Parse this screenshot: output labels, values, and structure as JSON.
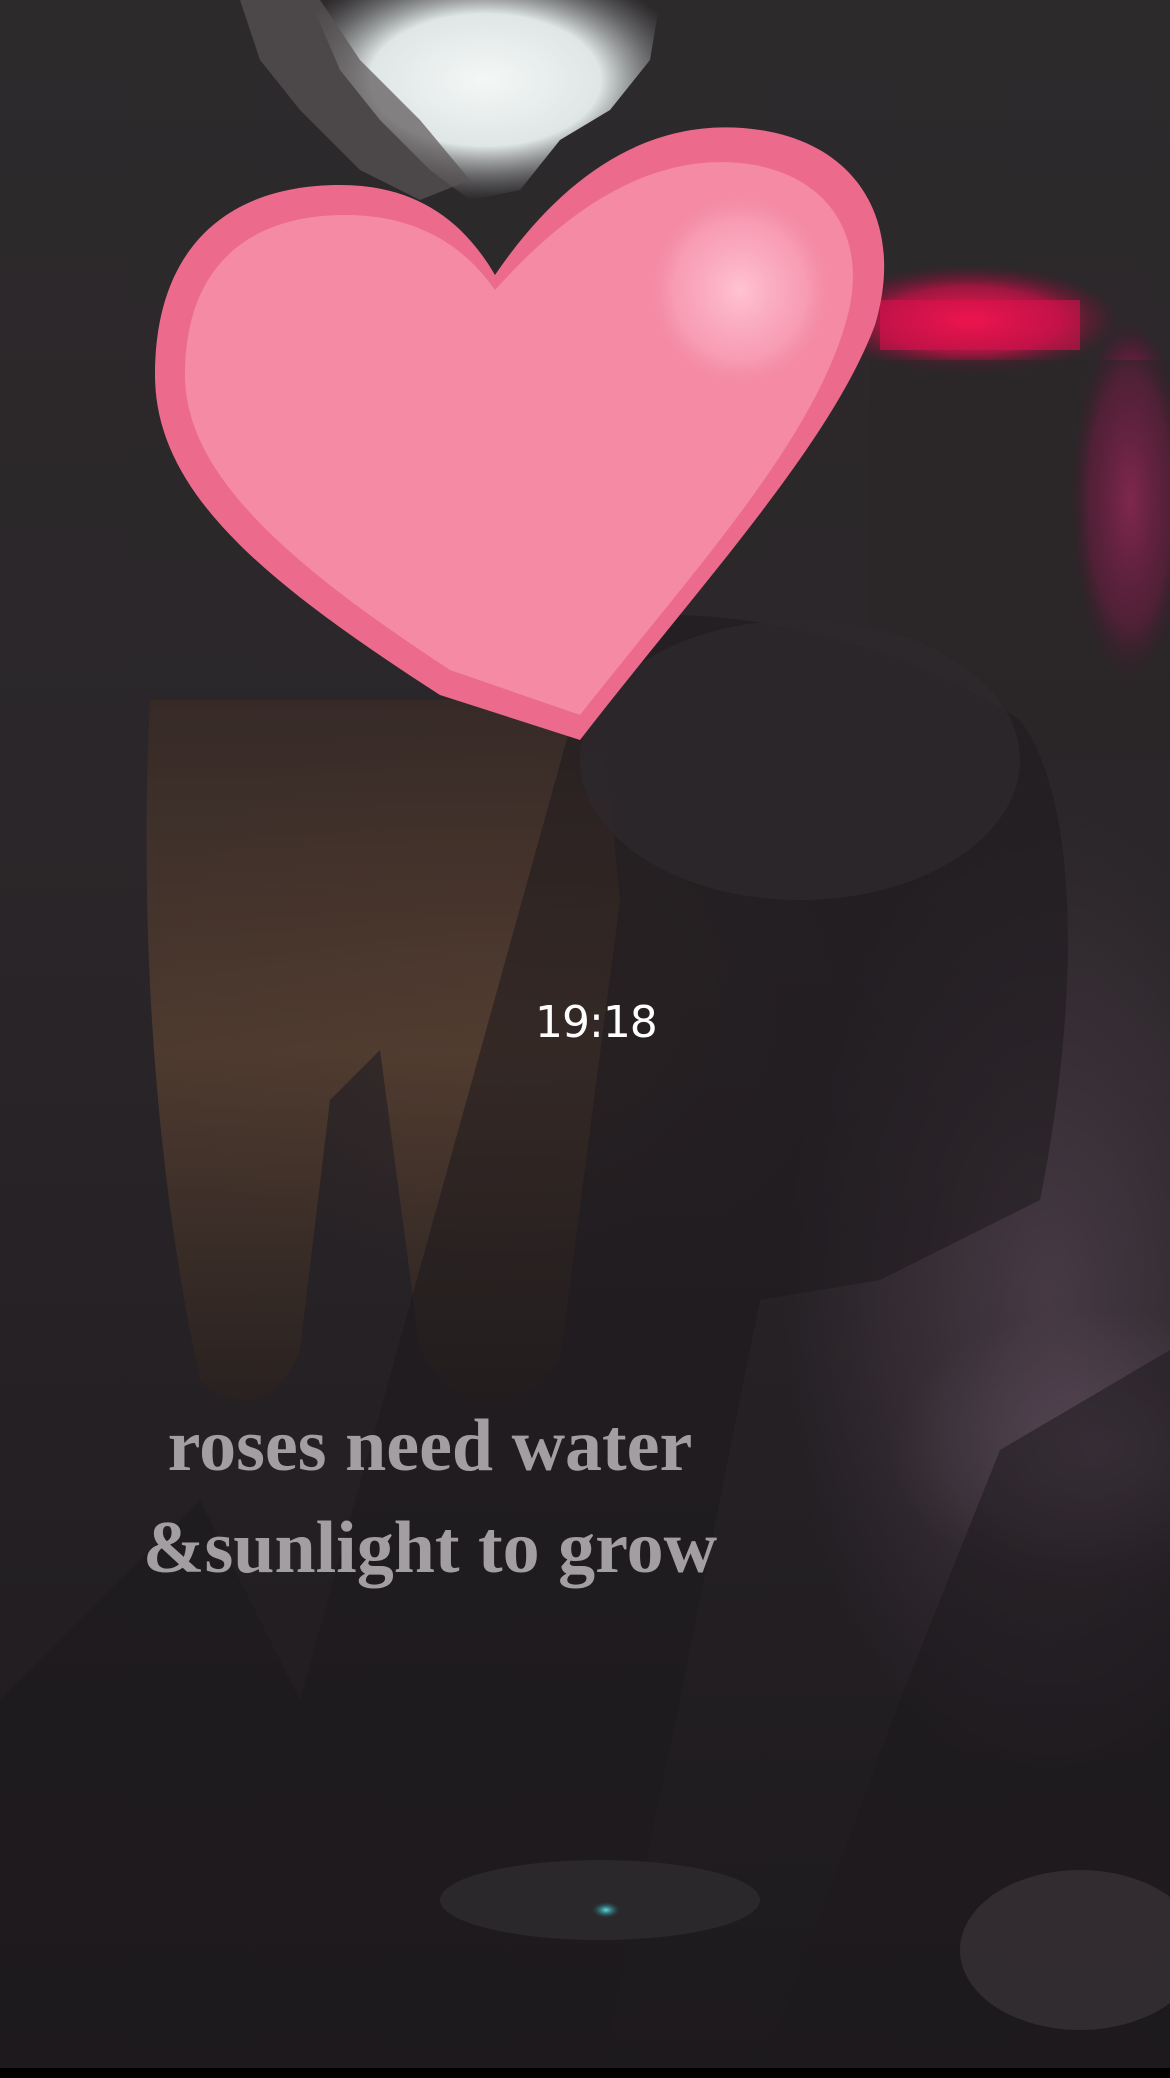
{
  "story": {
    "timestamp": "19:18",
    "caption": {
      "line1": "roses need water",
      "line2": "&sunlight to grow"
    }
  },
  "sticker": {
    "icon": "heart-sticker",
    "fill_color": "#f48aa4",
    "outline_color": "#ec6b8d"
  },
  "colors": {
    "caption_text": "#a39ea1",
    "timestamp_text": "#ffffff",
    "neon_light": "#e0114e"
  }
}
